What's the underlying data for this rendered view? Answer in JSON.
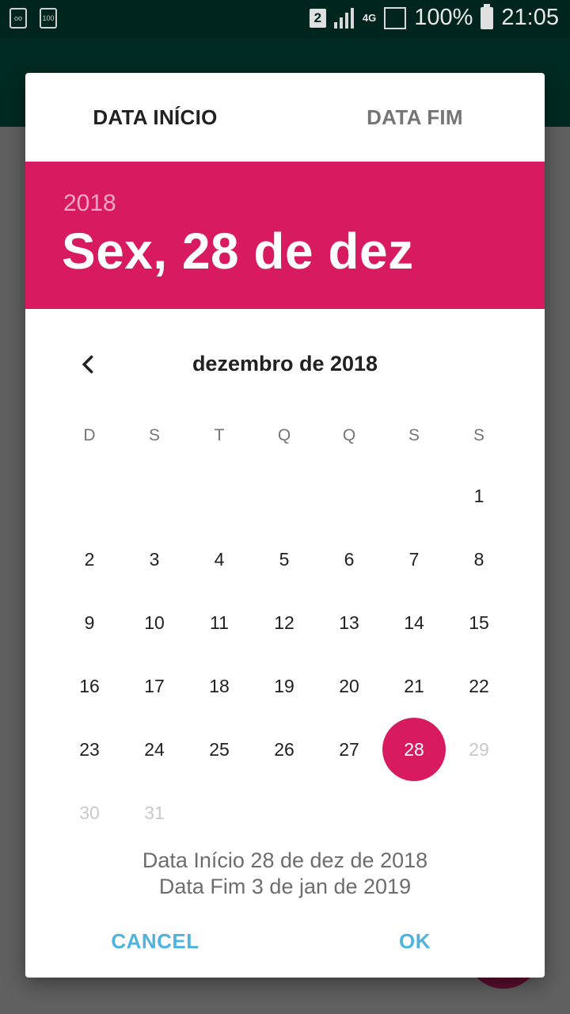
{
  "status_bar": {
    "sim_slot": "2",
    "network": "4G",
    "battery": "100%",
    "time": "21:05"
  },
  "dialog": {
    "tabs": [
      {
        "label": "DATA INÍCIO",
        "active": true
      },
      {
        "label": "DATA FIM",
        "active": false
      }
    ],
    "header": {
      "year": "2018",
      "date": "Sex, 28 de dez",
      "color": "#d81b60"
    },
    "calendar": {
      "month_title": "dezembro de 2018",
      "prev_icon": "chevron-left-icon",
      "weekdays": [
        "D",
        "S",
        "T",
        "Q",
        "Q",
        "S",
        "S"
      ],
      "days": [
        "1",
        "2",
        "3",
        "4",
        "5",
        "6",
        "7",
        "8",
        "9",
        "10",
        "11",
        "12",
        "13",
        "14",
        "15",
        "16",
        "17",
        "18",
        "19",
        "20",
        "21",
        "22",
        "23",
        "24",
        "25",
        "26",
        "27",
        "28",
        "29",
        "30",
        "31"
      ],
      "selected_day": "28",
      "disabled_days": [
        "29",
        "30",
        "31"
      ]
    },
    "summary": {
      "start": "Data Início 28 de dez de 2018",
      "end": "Data Fim 3 de jan de 2019"
    },
    "actions": {
      "cancel": "CANCEL",
      "ok": "OK",
      "color": "#4fb3e0"
    }
  }
}
